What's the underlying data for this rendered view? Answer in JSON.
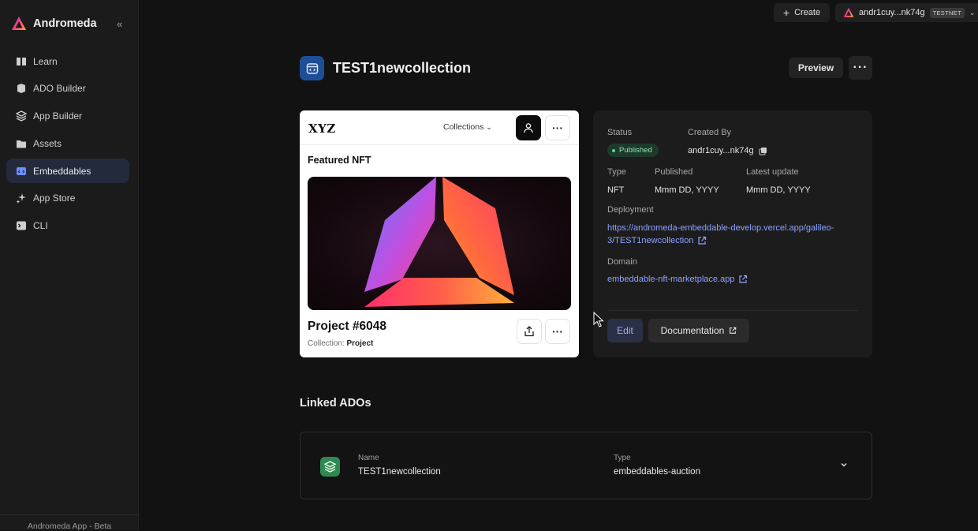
{
  "app": {
    "name": "Andromeda",
    "footer": "Andromeda App - Beta"
  },
  "sidebar": {
    "items": [
      {
        "label": "Learn",
        "icon": "book-icon"
      },
      {
        "label": "ADO Builder",
        "icon": "blocks-icon"
      },
      {
        "label": "App Builder",
        "icon": "layers-icon"
      },
      {
        "label": "Assets",
        "icon": "folder-icon"
      },
      {
        "label": "Embeddables",
        "icon": "embed-icon",
        "active": true
      },
      {
        "label": "App Store",
        "icon": "sparkle-icon"
      },
      {
        "label": "CLI",
        "icon": "terminal-icon"
      }
    ]
  },
  "topbar": {
    "create_label": "Create",
    "wallet_address": "andr1cuy...nk74g",
    "network_badge": "TESTNET"
  },
  "page": {
    "title": "TEST1newcollection",
    "preview_label": "Preview"
  },
  "preview_card": {
    "logo": "XYZ",
    "collections_label": "Collections",
    "featured_label": "Featured NFT",
    "project_name": "Project #6048",
    "collection_prefix": "Collection:",
    "collection_name": "Project"
  },
  "details": {
    "status_label": "Status",
    "status_value": "Published",
    "created_by_label": "Created By",
    "created_by_value": "andr1cuy...nk74g",
    "type_label": "Type",
    "type_value": "NFT",
    "published_label": "Published",
    "published_value": "Mmm DD, YYYY",
    "latest_update_label": "Latest update",
    "latest_update_value": "Mmm DD, YYYY",
    "deployment_label": "Deployment",
    "deployment_line1": "https://andromeda-embeddable-develop.vercel.app/galileo-",
    "deployment_line2": "3/TEST1newcollection",
    "domain_label": "Domain",
    "domain_value": "embeddable-nft-marketplace.app",
    "edit_label": "Edit",
    "documentation_label": "Documentation"
  },
  "linked": {
    "title": "Linked ADOs",
    "items": [
      {
        "name_label": "Name",
        "name": "TEST1newcollection",
        "type_label": "Type",
        "type": "embeddables-auction"
      }
    ]
  },
  "colors": {
    "accent": "#8ea2ff",
    "published_green": "#5fd38f",
    "page_icon_blue": "#1e4f96",
    "linked_icon_green": "#2f8a52"
  }
}
